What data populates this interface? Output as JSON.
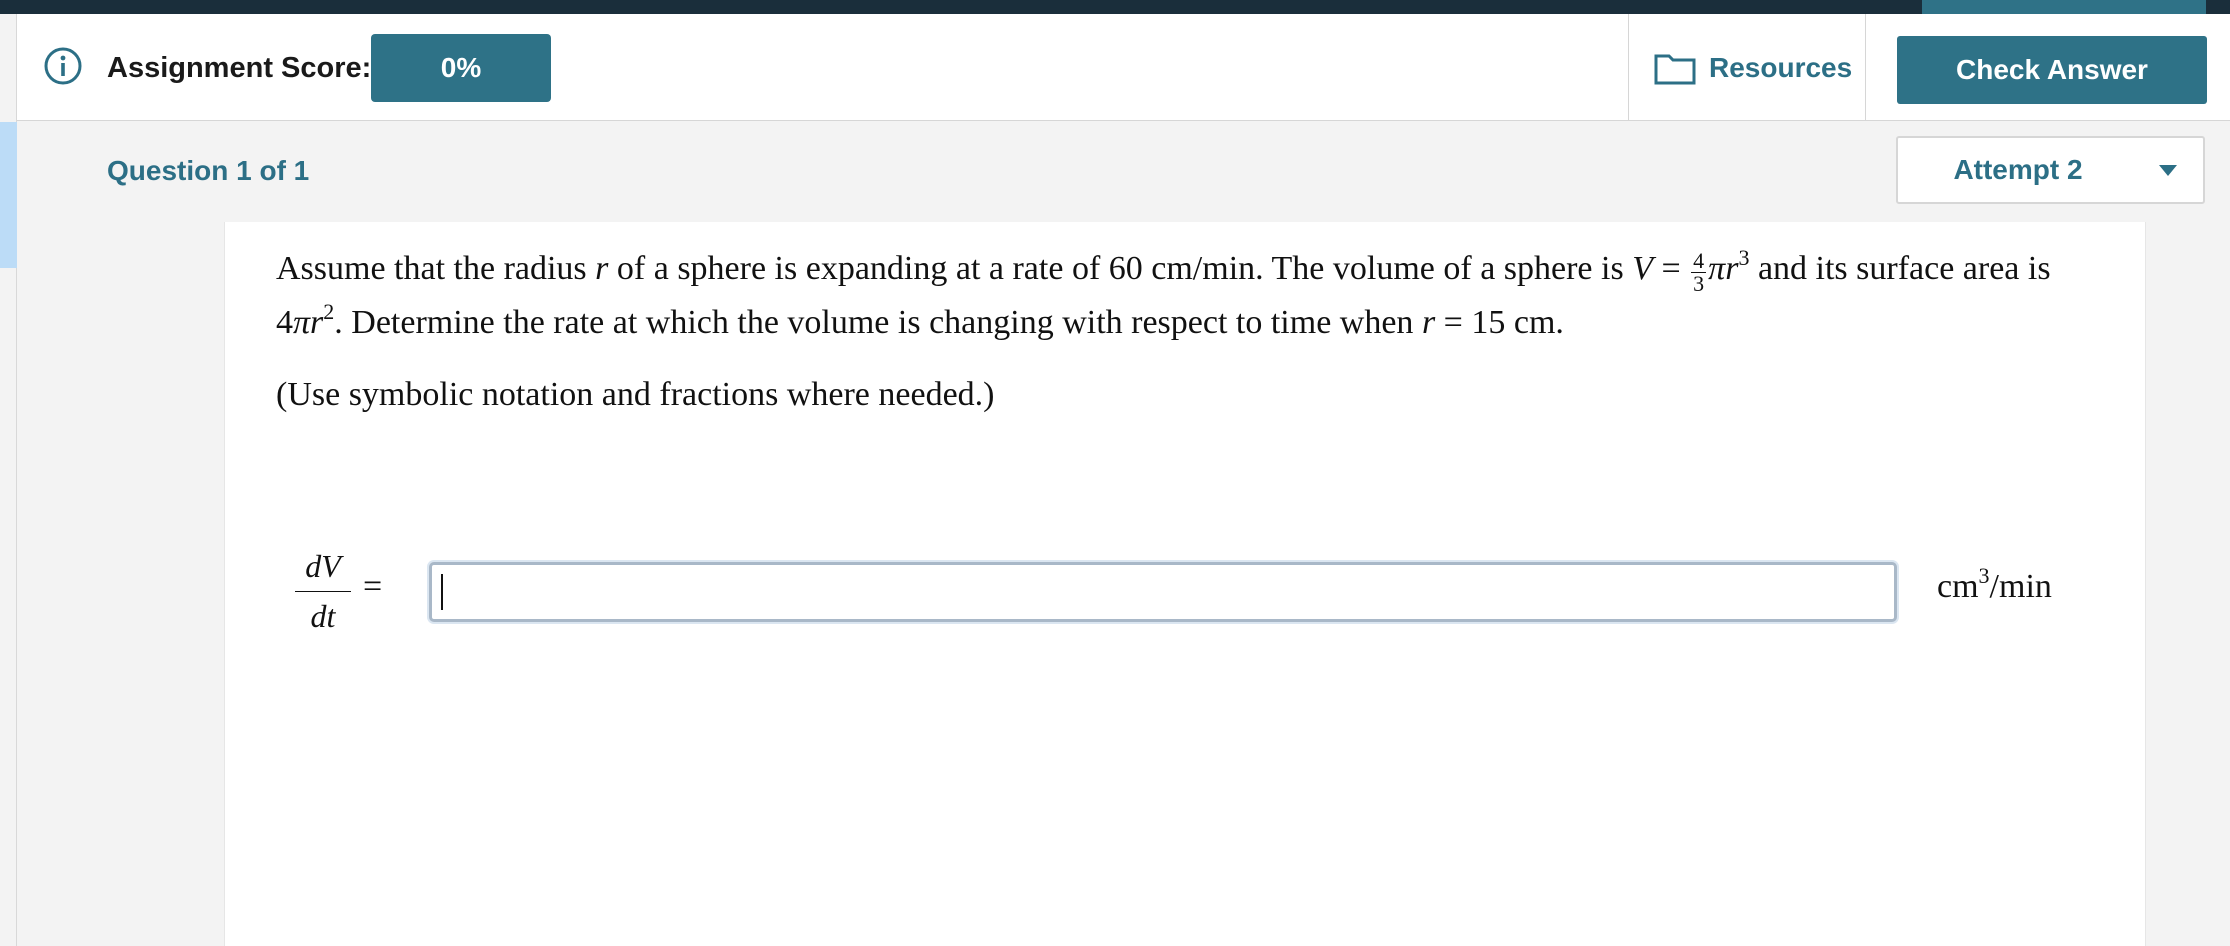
{
  "header": {
    "score_label": "Assignment Score:",
    "score_value": "0%",
    "resources_label": "Resources",
    "check_answer_label": "Check Answer"
  },
  "question_nav": {
    "question_label": "Question 1 of 1",
    "attempt_label": "Attempt 2"
  },
  "question": {
    "p1_a": "Assume that the radius ",
    "p1_r": "r",
    "p1_b": " of a sphere is expanding at a rate of 60 cm/min. The volume of a sphere is ",
    "p1_V": "V",
    "p1_eq": " = ",
    "frac_num": "4",
    "frac_den": "3",
    "p1_pi_r": "πr",
    "p1_exp3": "3",
    "p1_c": " and its surface area is 4",
    "p1_pi_r2": "πr",
    "p1_exp2": "2",
    "p1_d": ". Determine the rate at which the volume is changing with respect to time when ",
    "p1_r2": "r",
    "p1_e": " = 15 cm.",
    "hint": "(Use symbolic notation and fractions where needed.)"
  },
  "answer": {
    "lhs_top": "dV",
    "lhs_bottom": "dt",
    "equals": "=",
    "input_value": "",
    "unit_base": "cm",
    "unit_exp": "3",
    "unit_rest": "/min"
  },
  "colors": {
    "accent": "#2e7287",
    "link": "#2c6f86",
    "top_stripe": "#1a2e3b"
  },
  "icons": [
    "info-icon",
    "folder-icon",
    "chevron-down-icon"
  ]
}
